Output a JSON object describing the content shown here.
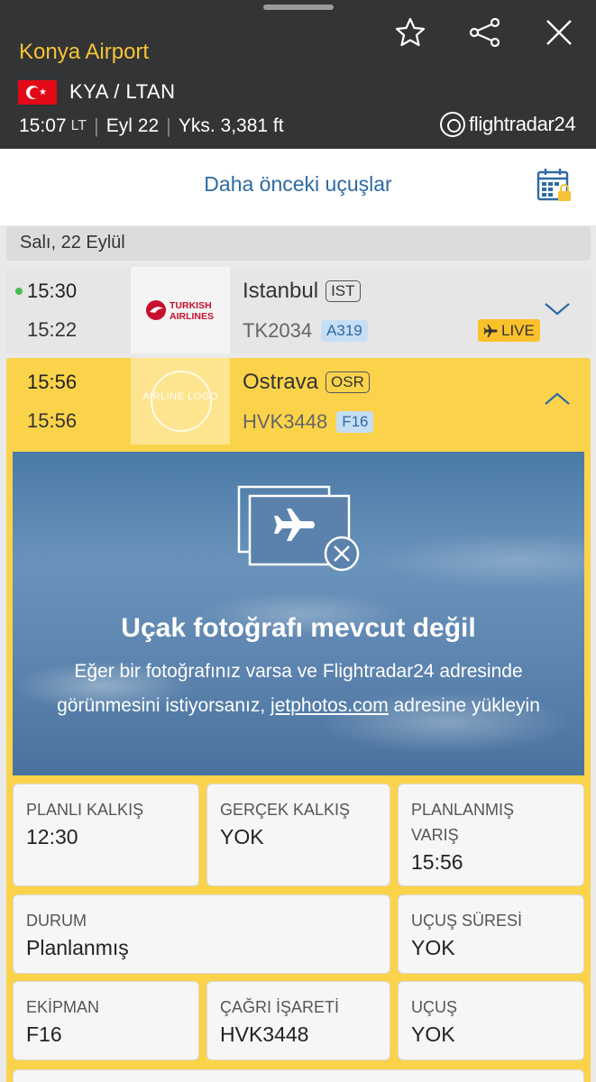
{
  "header": {
    "airport_name": "Konya Airport",
    "codes": "KYA / LTAN",
    "local_time": "15:07",
    "local_time_suffix": "LT",
    "date": "Eyl 22",
    "elevation": "Yks. 3,381 ft",
    "brand": "flightradar24",
    "icons": [
      "star-icon",
      "share-icon",
      "close-icon"
    ]
  },
  "earlier_flights_label": "Daha önceki uçuşlar",
  "date_header": "Salı, 22 Eylül",
  "flights": [
    {
      "scheduled_time": "15:30",
      "actual_time": "15:22",
      "airline_logo_text": "TURKISH AIRLINES",
      "destination": "Istanbul",
      "destination_code": "IST",
      "flight_number": "TK2034",
      "aircraft": "A319",
      "live_label": "LIVE"
    },
    {
      "scheduled_time": "15:56",
      "actual_time": "15:56",
      "airline_logo_text": "AIRLINE LOGO",
      "destination": "Ostrava",
      "destination_code": "OSR",
      "flight_number": "HVK3448",
      "aircraft": "F16"
    }
  ],
  "photo": {
    "title": "Uçak fotoğrafı mevcut değil",
    "desc_part1": "Eğer bir fotoğrafınız varsa ve Flightradar24 adresinde görünmesini istiyorsanız,",
    "link": "jetphotos.com",
    "desc_part2": "adresine yükleyin"
  },
  "details": {
    "planned_departure": {
      "label": "PLANLI KALKIŞ",
      "value": "12:30"
    },
    "actual_departure": {
      "label": "GERÇEK KALKIŞ",
      "value": "YOK"
    },
    "planned_arrival": {
      "label": "PLANLANMIŞ VARIŞ",
      "value": "15:56"
    },
    "status": {
      "label": "DURUM",
      "value": "Planlanmış"
    },
    "flight_duration": {
      "label": "UÇUŞ SÜRESİ",
      "value": "YOK"
    },
    "equipment": {
      "label": "EKİPMAN",
      "value": "F16"
    },
    "callsign": {
      "label": "ÇAĞRI İŞARETİ",
      "value": "HVK3448"
    },
    "flight": {
      "label": "UÇUŞ",
      "value": "YOK"
    }
  },
  "colors": {
    "header_bg": "#333435",
    "accent_yellow": "#f6c436",
    "selected_row": "#fbd34b",
    "link_blue": "#2d6aa3"
  }
}
